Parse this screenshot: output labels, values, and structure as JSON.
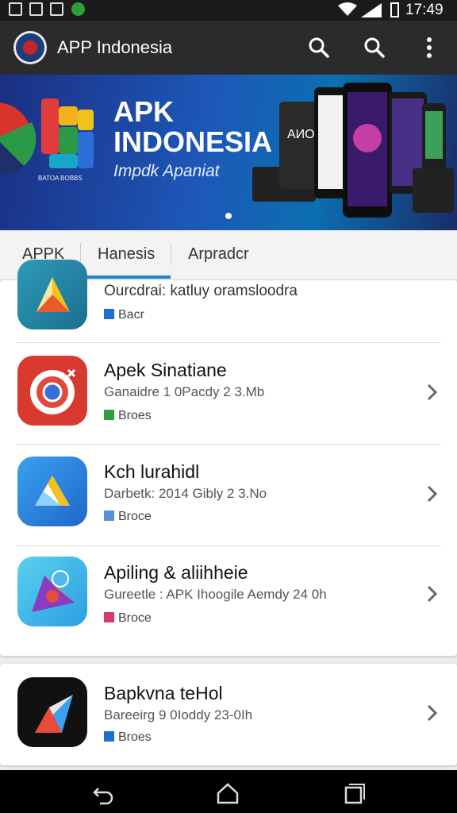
{
  "status_bar": {
    "time": "17:49"
  },
  "app_bar": {
    "title": "APP Indonesia",
    "icons": [
      "search-icon",
      "search-icon",
      "more-vert-icon"
    ]
  },
  "banner": {
    "title_line1": "APK",
    "title_line2": "INDONESIA",
    "subtitle": "Impdk Apaniat",
    "small_text": "BATOA BOBBS",
    "device_label": "AИO"
  },
  "tabs": [
    {
      "label": "APPK"
    },
    {
      "label": "Hanesis",
      "active": true
    },
    {
      "label": "Arpradcr"
    }
  ],
  "apps": [
    {
      "name": "Ourcdrai: katluy oramsloodra",
      "meta": "",
      "tag": "Bacr",
      "tag_color": "#1e6fd0",
      "icon": "triangle-app-icon"
    },
    {
      "name": "Apek Sinatiane",
      "meta": "Ganaidre 1 0Pacdy 2 3.Mb",
      "tag": "Broes",
      "tag_color": "#2e9e3c",
      "icon": "chrome-icon"
    },
    {
      "name": "Kch lurahidl",
      "meta": "Darbetk: 2014 Gibly 2 3.No",
      "tag": "Broce",
      "tag_color": "#5a8ed8",
      "icon": "drive-icon"
    },
    {
      "name": "Apiling & aliihheie",
      "meta": "Gureetle : APK Ihoogile Aemdy 24 0h",
      "tag": "Broce",
      "tag_color": "#d63b6e",
      "icon": "colorful-app-icon"
    },
    {
      "name": "Bapkvna teHol",
      "meta": "Bareeirg 9 0Ioddy 23-0Ih",
      "tag": "Broes",
      "tag_color": "#1e6fd0",
      "icon": "play-app-icon"
    }
  ],
  "nav_bar": {
    "icons": [
      "back-icon",
      "home-icon",
      "recents-icon"
    ]
  },
  "colors": {
    "appbar": "#2b2b2b",
    "accent": "#1c84c6",
    "statusbar": "#1b1b1b"
  }
}
